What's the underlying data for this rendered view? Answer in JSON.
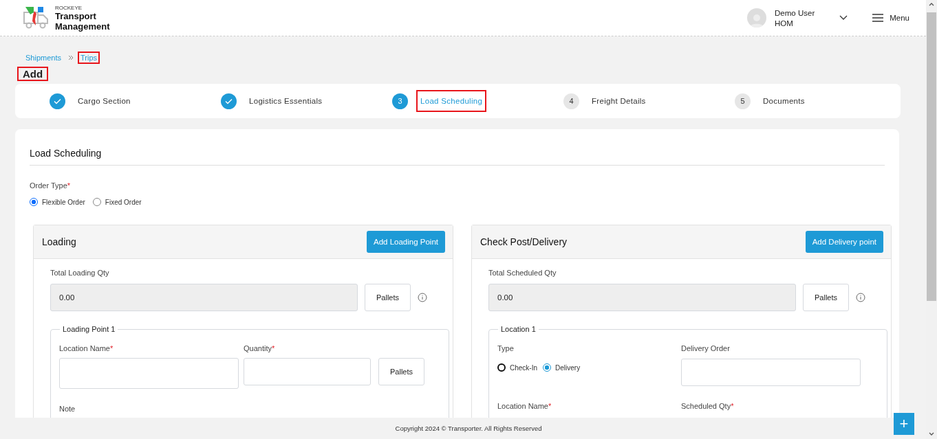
{
  "header": {
    "brand_small": "ROCKEYE",
    "brand_line1": "Transport",
    "brand_line2": "Management",
    "user_name": "Demo User",
    "user_role": "HOM",
    "menu_label": "Menu"
  },
  "breadcrumb": [
    {
      "label": "Shipments",
      "highlighted": false
    },
    {
      "label": "Trips",
      "highlighted": true
    }
  ],
  "page_title": {
    "text": "Add",
    "highlighted": true
  },
  "steps": [
    {
      "label": "Cargo Section",
      "completed": true,
      "selected": false,
      "highlighted": false
    },
    {
      "label": "Logistics Essentials",
      "completed": true,
      "selected": false,
      "highlighted": false
    },
    {
      "number": "3",
      "label": "Load Scheduling",
      "completed": false,
      "selected": true,
      "highlighted": true
    },
    {
      "number": "4",
      "label": "Freight Details",
      "completed": false,
      "selected": false,
      "highlighted": false
    },
    {
      "number": "5",
      "label": "Documents",
      "completed": false,
      "selected": false,
      "highlighted": false
    }
  ],
  "section_title": "Load Scheduling",
  "order_type": {
    "label": "Order Type",
    "required": "*",
    "options": [
      {
        "label": "Flexible Order",
        "selected": true
      },
      {
        "label": "Fixed Order",
        "selected": false
      }
    ]
  },
  "loading": {
    "title": "Loading",
    "button": "Add Loading Point",
    "total_label": "Total Loading Qty",
    "total_value": "0.00",
    "unit": "Pallets",
    "point": {
      "legend": "Loading Point 1",
      "location_label": "Location Name",
      "location_required": "*",
      "quantity_label": "Quantity",
      "quantity_required": "*",
      "unit": "Pallets",
      "note_label": "Note"
    }
  },
  "delivery": {
    "title": "Check Post/Delivery",
    "button": "Add Delivery point",
    "total_label": "Total Scheduled Qty",
    "total_value": "0.00",
    "unit": "Pallets",
    "location": {
      "legend": "Location 1",
      "type_label": "Type",
      "types": [
        {
          "label": "Check-In",
          "selected": false
        },
        {
          "label": "Delivery",
          "selected": true
        }
      ],
      "order_label": "Delivery Order",
      "location_label": "Location Name",
      "location_required": "*",
      "qty_label": "Scheduled Qty",
      "qty_required": "*"
    }
  },
  "footer": "Copyright 2024 © Transporter. All Rights Reserved",
  "fab": "+"
}
